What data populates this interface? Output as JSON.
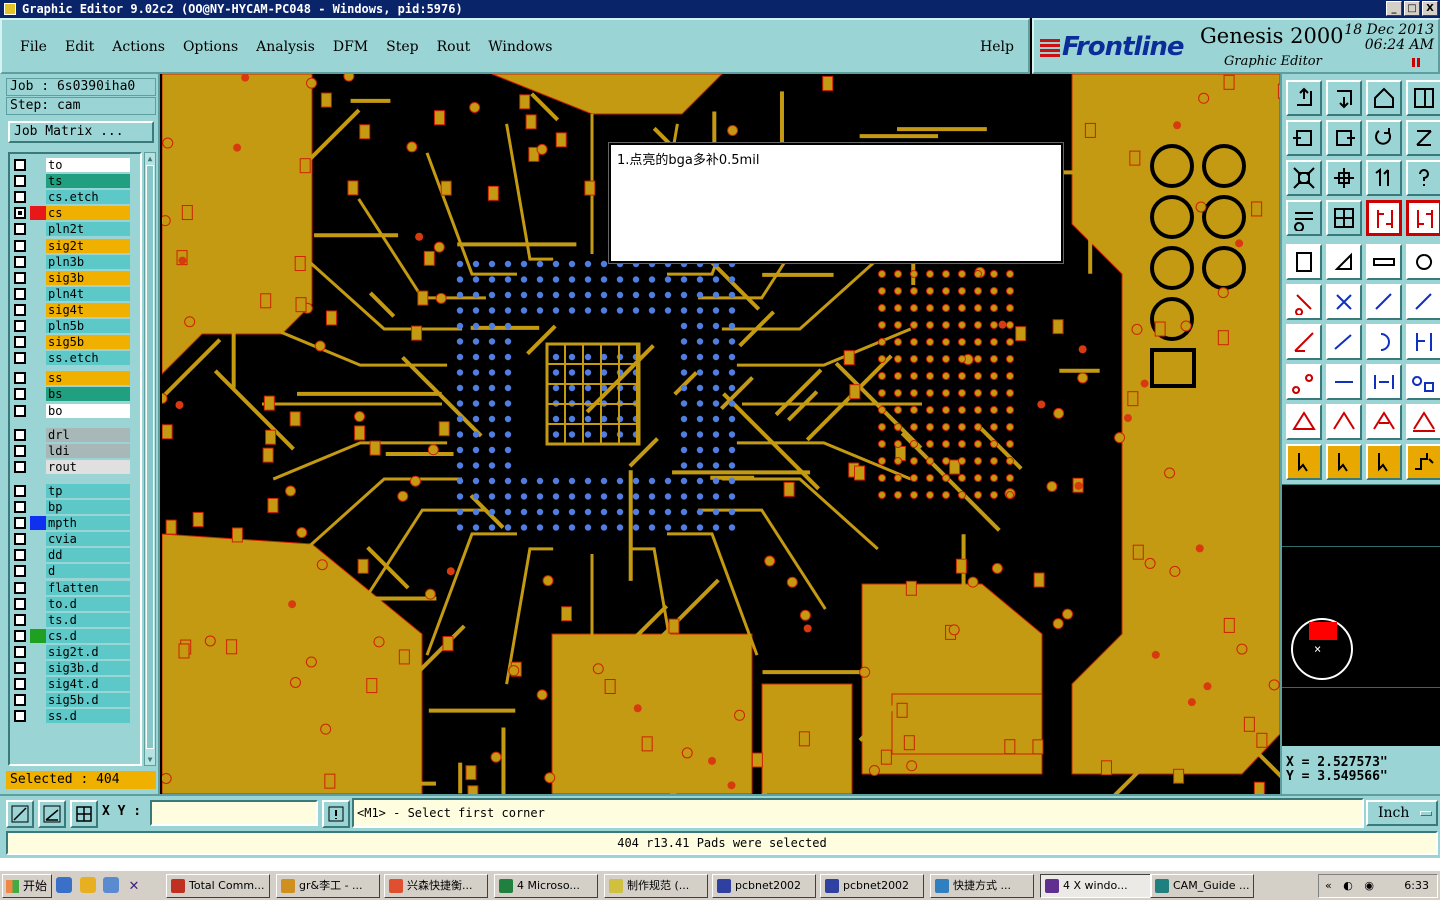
{
  "window": {
    "title": "Graphic Editor 9.02c2  (OO@NY-HYCAM-PC048 - Windows, pid:5976)",
    "min": "_",
    "max": "□",
    "close": "X"
  },
  "menu": {
    "items": [
      "File",
      "Edit",
      "Actions",
      "Options",
      "Analysis",
      "DFM",
      "Step",
      "Rout",
      "Windows"
    ],
    "help": "Help"
  },
  "brand": {
    "logo": "Frontline",
    "product": "Genesis 2000",
    "subtitle": "Graphic Editor",
    "date": "18 Dec 2013",
    "time": "06:24 AM"
  },
  "job": {
    "job": "Job : 6s0390iha0",
    "step": "Step: cam",
    "matrix_button": "Job Matrix ..."
  },
  "layers": [
    {
      "name": "to",
      "color": "#ffffff",
      "arrow": true
    },
    {
      "name": "ts",
      "color": "#20a080",
      "arrow": true
    },
    {
      "name": "cs.etch",
      "color": "#5cc8c8",
      "arrow": false
    },
    {
      "name": "cs",
      "color": "#f0b000",
      "arrow": true,
      "active": true
    },
    {
      "name": "pln2t",
      "color": "#5cc8c8",
      "arrow": false
    },
    {
      "name": "sig2t",
      "color": "#f0b000",
      "arrow": true
    },
    {
      "name": "pln3b",
      "color": "#5cc8c8",
      "arrow": false
    },
    {
      "name": "sig3b",
      "color": "#f0b000",
      "arrow": true
    },
    {
      "name": "pln4t",
      "color": "#5cc8c8",
      "arrow": false
    },
    {
      "name": "sig4t",
      "color": "#f0b000",
      "arrow": true
    },
    {
      "name": "pln5b",
      "color": "#5cc8c8",
      "arrow": false
    },
    {
      "name": "sig5b",
      "color": "#f0b000",
      "arrow": true
    },
    {
      "name": "ss.etch",
      "color": "#5cc8c8",
      "arrow": false
    },
    {
      "name": "ss",
      "color": "#f0b000",
      "arrow": true
    },
    {
      "name": "bs",
      "color": "#20a080",
      "arrow": true
    },
    {
      "name": "bo",
      "color": "#ffffff",
      "arrow": true
    },
    {
      "name": "drl",
      "color": "#a8b8b8",
      "arrow": false
    },
    {
      "name": "ldi",
      "color": "#a8b8b8",
      "arrow": false
    },
    {
      "name": "rout",
      "color": "#e0e0e0",
      "arrow": false
    },
    {
      "name": "tp",
      "color": "#5cc8c8",
      "arrow": false
    },
    {
      "name": "bp",
      "color": "#5cc8c8",
      "arrow": false
    },
    {
      "name": "mpth",
      "color": "#5cc8c8",
      "arrow": false,
      "mark": "#1030f0"
    },
    {
      "name": "cvia",
      "color": "#5cc8c8",
      "arrow": false
    },
    {
      "name": "dd",
      "color": "#5cc8c8",
      "arrow": true
    },
    {
      "name": "d",
      "color": "#5cc8c8",
      "arrow": false
    },
    {
      "name": "flatten",
      "color": "#5cc8c8",
      "arrow": false
    },
    {
      "name": "to.d",
      "color": "#5cc8c8",
      "arrow": true
    },
    {
      "name": "ts.d",
      "color": "#5cc8c8",
      "arrow": true
    },
    {
      "name": "cs.d",
      "color": "#5cc8c8",
      "arrow": true,
      "mark": "#20a020"
    },
    {
      "name": "sig2t.d",
      "color": "#5cc8c8",
      "arrow": true
    },
    {
      "name": "sig3b.d",
      "color": "#5cc8c8",
      "arrow": true
    },
    {
      "name": "sig4t.d",
      "color": "#5cc8c8",
      "arrow": true
    },
    {
      "name": "sig5b.d",
      "color": "#5cc8c8",
      "arrow": true
    },
    {
      "name": "ss.d",
      "color": "#5cc8c8",
      "arrow": true
    }
  ],
  "selected": "Selected : 404",
  "note": "1.点亮的bga多补0.5mil",
  "coords": {
    "x": "X = 2.527573\"",
    "y": "Y = 3.549566\""
  },
  "bottom": {
    "xy_label": "X Y :",
    "xy_value": "",
    "prompt": "<M1> - Select first corner",
    "unit": "Inch"
  },
  "status": "404 r13.41 Pads were selected",
  "taskbar": {
    "start": "开始",
    "tasks": [
      "Total Comm...",
      "gr&李工 - ...",
      "兴森快捷衡...",
      "4 Microso...",
      "制作规范 (...",
      "pcbnet2002",
      "pcbnet2002",
      "快捷方式 ...",
      "4 X windo...",
      "CAM_Guide ..."
    ],
    "clock": "6:33"
  },
  "colors": {
    "copper": "#c49a12",
    "pad": "#4f7ee0",
    "panel": "#9ad4d4",
    "outline": "#cc2200"
  }
}
